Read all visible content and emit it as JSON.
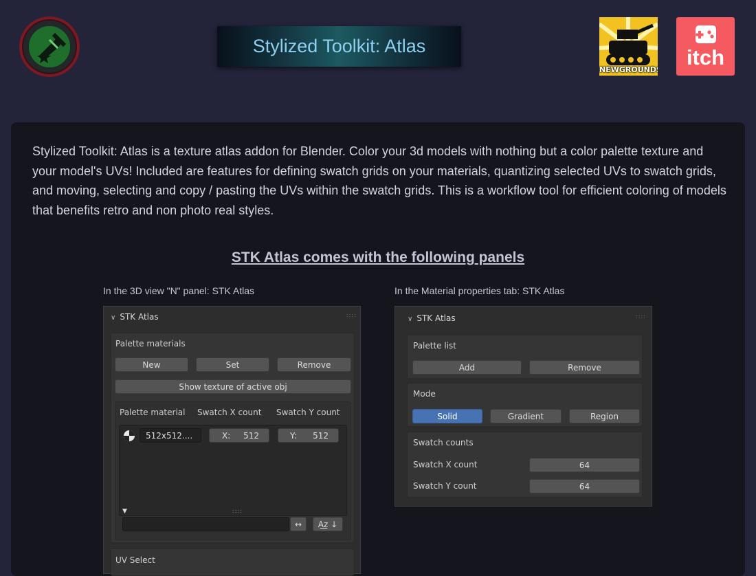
{
  "header": {
    "title": "Stylized Toolkit: Atlas",
    "newgrounds_label": "NEWGROUNDS",
    "itch_label": "itch"
  },
  "intro_text": "Stylized Toolkit: Atlas is a texture atlas addon for Blender. Color your 3d models with nothing but a color palette texture and your model's UVs! Included are features for defining swatch grids on your materials, quantizing selected UVs to swatch grids, and moving, selecting and copy / pasting the UVs within the swatch grids. This is a workflow tool for efficient coloring of models that benefits retro and non photo real styles.",
  "panels_heading": "STK Atlas comes with the following panels",
  "left": {
    "caption": "In the 3D view \"N\" panel: STK Atlas",
    "panel_title": "STK Atlas",
    "palette_materials": {
      "label": "Palette materials",
      "new": "New",
      "set": "Set",
      "remove": "Remove",
      "show_texture": "Show texture of active obj"
    },
    "list": {
      "col_material": "Palette material",
      "col_x": "Swatch X count",
      "col_y": "Swatch Y count",
      "row_name": "512x512....",
      "row_x_label": "X:",
      "row_x_value": "512",
      "row_y_label": "Y:",
      "row_y_value": "512",
      "swap_glyph": "↔",
      "sort_glyph": "A͟z ↓"
    },
    "uv_select": "UV Select"
  },
  "right": {
    "caption": "In the Material properties tab: STK Atlas",
    "panel_title": "STK Atlas",
    "palette_list": {
      "label": "Palette list",
      "add": "Add",
      "remove": "Remove"
    },
    "mode": {
      "label": "Mode",
      "options": [
        "Solid",
        "Gradient",
        "Region"
      ],
      "selected": "Solid"
    },
    "swatch_counts": {
      "label": "Swatch counts",
      "x_label": "Swatch X count",
      "x_value": "64",
      "y_label": "Swatch Y count",
      "y_value": "64"
    }
  },
  "colors": {
    "page_bg": "#23243a",
    "card_bg": "#15151e",
    "title_text": "#8fd0f0",
    "itch_red": "#f45a5f",
    "newgrounds_yellow": "#f2c220",
    "blender_active": "#4772b3"
  },
  "icons": [
    "trumpet-logo-icon",
    "newgrounds-tank-icon",
    "itch-controller-icon",
    "material-sphere-icon",
    "chevron-down-icon",
    "drag-grip-icon"
  ]
}
